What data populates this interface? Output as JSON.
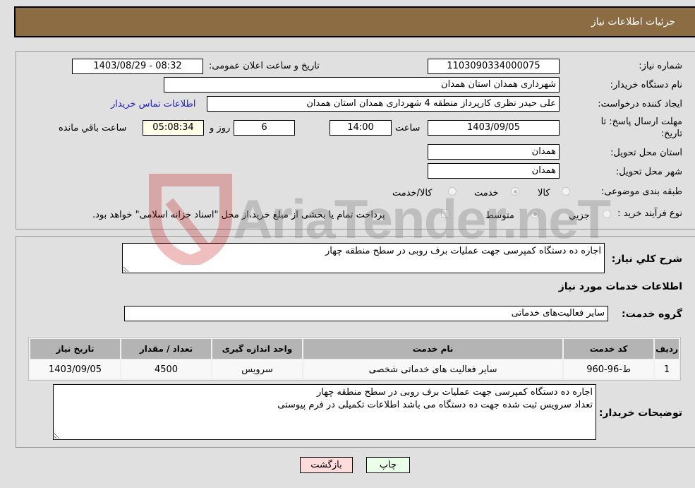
{
  "header": {
    "title": "جزئیات اطلاعات نیاز"
  },
  "form": {
    "need_number": {
      "label": "شماره نیاز:",
      "value": "1103090334000075"
    },
    "announce_datetime": {
      "label": "تاریخ و ساعت اعلان عمومی:",
      "value": "1403/08/29 - 08:32"
    },
    "buyer_org": {
      "label": "نام دستگاه خریدار:",
      "value": "شهرداری همدان استان همدان"
    },
    "requester": {
      "label": "ایجاد کننده درخواست:",
      "value": "علی حیدر نظری کارپرداز منطقه 4 شهرداری همدان استان همدان"
    },
    "buyer_contact_link": "اطلاعات تماس خریدار",
    "deadline": {
      "label_line1": "مهلت ارسال پاسخ: تا",
      "label_line2": "تاریخ:",
      "date": "1403/09/05",
      "time_label": "ساعت",
      "time": "14:00",
      "days": "6",
      "days_label": "روز و",
      "remaining": "05:08:34",
      "remaining_label": "ساعت باقي مانده"
    },
    "province": {
      "label": "استان محل تحویل:",
      "value": "همدان"
    },
    "city": {
      "label": "شهر محل تحویل:",
      "value": "همدان"
    },
    "category": {
      "label": "طبقه بندی موضوعی:",
      "options": [
        "کالا",
        "خدمت",
        "کالا/خدمت"
      ],
      "selected": "خدمت"
    },
    "purchase_type": {
      "label": "نوع فرآیند خرید :",
      "options": [
        "جزيي",
        "متوسط"
      ],
      "selected": "متوسط",
      "treasury_note": "پرداخت تمام یا بخشی از مبلغ خرید،از محل \"اسناد خزانه اسلامی\" خواهد بود."
    }
  },
  "details": {
    "description_label": "شرح کلي نياز:",
    "description": "اجاره ده دستگاه کمپرسی جهت عملیات برف روبی در سطح منطقه چهار",
    "services_heading": "اطلاعات خدمات مورد نیاز",
    "service_group_label": "گروه خدمت:",
    "service_group": "سایر فعالیت‌های خدماتی",
    "table": {
      "headers": [
        "ردیف",
        "کد خدمت",
        "نام خدمت",
        "واحد اندازه گیری",
        "تعداد / مقدار",
        "تاریخ نیاز"
      ],
      "rows": [
        [
          "1",
          "ط-96-960",
          "سایر فعالیت های خدماتی شخصی",
          "سرویس",
          "4500",
          "1403/09/05"
        ]
      ]
    },
    "buyer_notes_label": "توضیحات خریدار:",
    "buyer_notes": "اجاره ده دستگاه کمپرسی جهت عملیات برف روبی در سطح منطقه چهار\nتعداد سرویس ثبت شده جهت ده دستگاه می باشد اطلاعات تکمیلی در فرم پیوستی"
  },
  "buttons": {
    "print": "چاپ",
    "back": "بازگشت"
  },
  "watermark": {
    "text": "AriaTender.neT"
  },
  "colors": {
    "header_bg": "#8c6d43",
    "print_bg": "#eaffea",
    "back_bg": "#ffdcdc",
    "link": "#2020d0"
  }
}
